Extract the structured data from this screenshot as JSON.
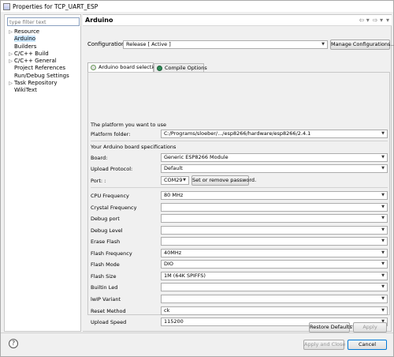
{
  "window": {
    "title": "Properties for TCP_UART_ESP"
  },
  "sidebar": {
    "filter_placeholder": "type filter text",
    "items": [
      {
        "label": "Resource",
        "expandable": true
      },
      {
        "label": "Arduino",
        "expandable": false,
        "selected": true
      },
      {
        "label": "Builders",
        "expandable": false
      },
      {
        "label": "C/C++ Build",
        "expandable": true
      },
      {
        "label": "C/C++ General",
        "expandable": true
      },
      {
        "label": "Project References",
        "expandable": false
      },
      {
        "label": "Run/Debug Settings",
        "expandable": false
      },
      {
        "label": "Task Repository",
        "expandable": true
      },
      {
        "label": "WikiText",
        "expandable": false
      }
    ]
  },
  "header": {
    "title": "Arduino",
    "back_glyph": "⇦ ▾",
    "forward_glyph": "⇨ ▾",
    "menu_glyph": "▾"
  },
  "config": {
    "label": "Configuration:",
    "value": "Release  [ Active ]",
    "manage_label": "Manage Configurations..."
  },
  "tabs": [
    {
      "label": "Arduino board selection",
      "active": true
    },
    {
      "label": "Compile Options",
      "active": false
    }
  ],
  "board": {
    "platform_heading": "The platform you want to use",
    "platform_folder_label": "Platform folder:",
    "platform_folder_value": "C:/Programs/sloeber/.../esp8266/hardware/esp8266/2.4.1",
    "spec_heading": "Your Arduino board specifications",
    "board_label": "Board:",
    "board_value": "Generic ESP8266 Module",
    "protocol_label": "Upload Protocol:",
    "protocol_value": "Default",
    "port_label": "Port: :",
    "port_value": "COM29",
    "password_button": "Set or remove password.",
    "options": [
      {
        "label": "CPU Frequency",
        "value": "80 MHz"
      },
      {
        "label": "Crystal Frequency",
        "value": ""
      },
      {
        "label": "Debug port",
        "value": ""
      },
      {
        "label": "Debug Level",
        "value": ""
      },
      {
        "label": "Erase Flash",
        "value": ""
      },
      {
        "label": "Flash Frequency",
        "value": "40MHz"
      },
      {
        "label": "Flash Mode",
        "value": "DIO"
      },
      {
        "label": "Flash Size",
        "value": "1M (64K SPIFFS)"
      },
      {
        "label": "Builtin Led",
        "value": ""
      },
      {
        "label": "lwIP Variant",
        "value": ""
      },
      {
        "label": "Reset Method",
        "value": "ck"
      },
      {
        "label": "Upload Speed",
        "value": "115200"
      }
    ]
  },
  "buttons": {
    "restore_defaults": "Restore Defaults",
    "apply": "Apply",
    "apply_and_close": "Apply and Close",
    "cancel": "Cancel"
  },
  "colors": {
    "selection": "#cce8ff",
    "accent": "#0078d7"
  }
}
